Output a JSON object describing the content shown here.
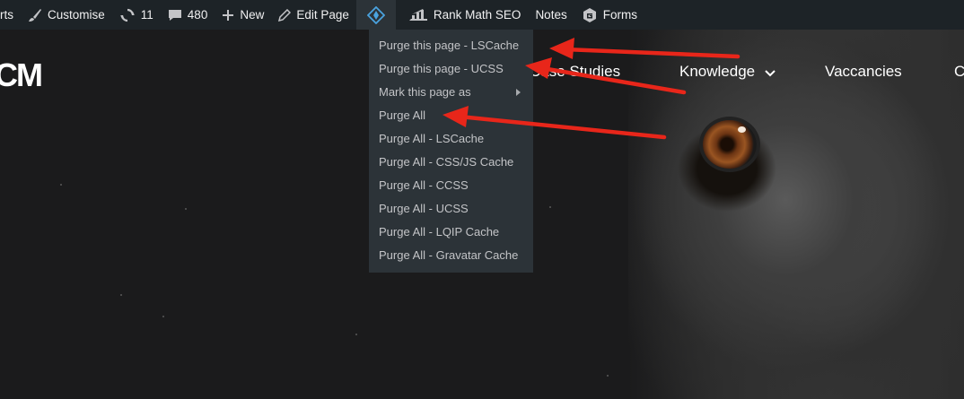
{
  "admin_bar": {
    "items": [
      {
        "label": "rts",
        "icon": ""
      },
      {
        "label": "Customise",
        "icon": "paintbrush-icon"
      },
      {
        "label": "11",
        "icon": "update-icon"
      },
      {
        "label": "480",
        "icon": "comment-icon"
      },
      {
        "label": "New",
        "icon": "plus-icon"
      },
      {
        "label": "Edit Page",
        "icon": "pencil-icon"
      },
      {
        "label": "",
        "icon": "litespeed-diamond-icon"
      },
      {
        "label": "Rank Math SEO",
        "icon": "rank-math-icon"
      },
      {
        "label": "Notes",
        "icon": ""
      },
      {
        "label": "Forms",
        "icon": "gravity-forms-icon"
      }
    ]
  },
  "litespeed_menu": {
    "items": [
      "Purge this page - LSCache",
      "Purge this page - UCSS",
      "Mark this page as",
      "Purge All",
      "Purge All - LSCache",
      "Purge All - CSS/JS Cache",
      "Purge All - CCSS",
      "Purge All - UCSS",
      "Purge All - LQIP Cache",
      "Purge All - Gravatar Cache"
    ]
  },
  "site": {
    "logo": "CM",
    "nav": [
      "Case Studies",
      "Knowledge",
      "Vaccancies",
      "C"
    ]
  },
  "colors": {
    "admin_bar_bg": "#1d2327",
    "menu_bg": "#2c3338",
    "menu_text": "#c3c4c7",
    "arrow": "#e8261a",
    "page_bg": "#1b1b1c"
  }
}
